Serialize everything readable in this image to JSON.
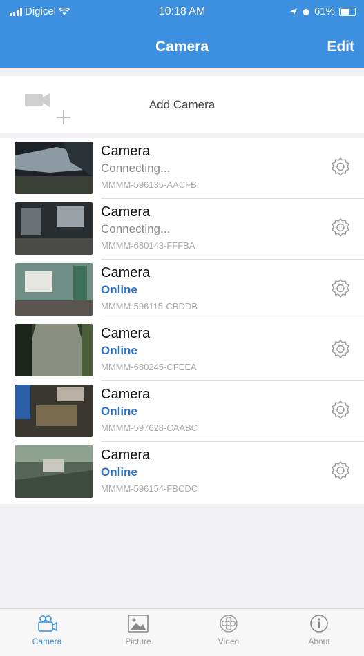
{
  "status_bar": {
    "carrier": "Digicel",
    "time": "10:18 AM",
    "battery": "61%"
  },
  "nav": {
    "title": "Camera",
    "edit_label": "Edit"
  },
  "add_camera": {
    "label": "Add Camera"
  },
  "cameras": [
    {
      "name": "Camera",
      "status": "Connecting...",
      "id": "MMMM-596135-AACFB",
      "online": false
    },
    {
      "name": "Camera",
      "status": "Connecting...",
      "id": "MMMM-680143-FFFBA",
      "online": false
    },
    {
      "name": "Camera",
      "status": "Online",
      "id": "MMMM-596115-CBDDB",
      "online": true
    },
    {
      "name": "Camera",
      "status": "Online",
      "id": "MMMM-680245-CFEEA",
      "online": true
    },
    {
      "name": "Camera",
      "status": "Online",
      "id": "MMMM-597628-CAABC",
      "online": true
    },
    {
      "name": "Camera",
      "status": "Online",
      "id": "MMMM-596154-FBCDC",
      "online": true
    }
  ],
  "tabs": [
    {
      "label": "Camera",
      "icon": "camera-tab-icon",
      "active": true
    },
    {
      "label": "Picture",
      "icon": "picture-tab-icon",
      "active": false
    },
    {
      "label": "Video",
      "icon": "video-tab-icon",
      "active": false
    },
    {
      "label": "About",
      "icon": "about-tab-icon",
      "active": false
    }
  ],
  "colors": {
    "accent": "#3d8fe0",
    "online": "#2f6fbf",
    "muted": "#888888"
  }
}
